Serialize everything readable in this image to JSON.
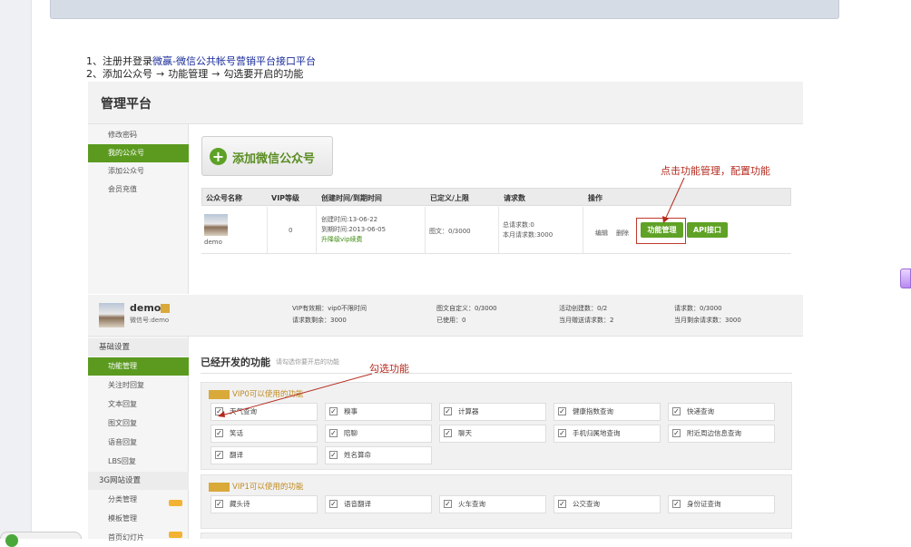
{
  "steps": {
    "s1_prefix": "1、注册并登录",
    "s1_link": "微赢-微信公共帐号营销平台接口平台",
    "s2_a": "2、添加公众号",
    "s2_arrow": "→",
    "s2_b": "功能管理",
    "s2_c": "勾选要开启的功能"
  },
  "panel1": {
    "title": "管理平台",
    "sidebar": [
      "修改密码",
      "我的公众号",
      "添加公众号",
      "会员充值"
    ],
    "add_button": "添加微信公众号",
    "plus": "+",
    "table_headers": [
      "公众号名称",
      "VIP等级",
      "创建时间/到期时间",
      "已定义/上限",
      "请求数",
      "操作"
    ],
    "row": {
      "name": "demo",
      "vip": "0",
      "created": "创建时间:13-06-22",
      "expires": "到期时间:2013-06-05",
      "upgrade": "升降级vip续费",
      "defined": "图文：0/3000",
      "total_req": "总请求数:0",
      "month_req": "本月请求数:3000",
      "edit": "编辑",
      "delete": "删除",
      "func_mgmt": "功能管理",
      "api": "API接口"
    },
    "annotation": "点击功能管理，配置功能"
  },
  "panel2": {
    "account_name": "demo",
    "account_wechat": "微信号:demo",
    "stats": [
      [
        "VIP有效期：vip0不限时间",
        "请求数剩余：3000"
      ],
      [
        "图文自定义：0/3000",
        "已使用：0"
      ],
      [
        "活动创建数：0/2",
        "当月赠送请求数：2"
      ],
      [
        "请求数：0/3000",
        "当月剩余请求数：3000"
      ]
    ],
    "sidebar": [
      {
        "label": "基础设置",
        "type": "group"
      },
      {
        "label": "功能管理",
        "type": "active"
      },
      {
        "label": "关注时回复",
        "type": "item"
      },
      {
        "label": "文本回复",
        "type": "item"
      },
      {
        "label": "图文回复",
        "type": "item"
      },
      {
        "label": "语音回复",
        "type": "item"
      },
      {
        "label": "LBS回复",
        "type": "item",
        "new": true
      },
      {
        "label": "3G网站设置",
        "type": "group"
      },
      {
        "label": "分类管理",
        "type": "item"
      },
      {
        "label": "模板管理",
        "type": "item"
      },
      {
        "label": "首页幻灯片",
        "type": "item",
        "new": true
      }
    ],
    "section_title": "已经开发的功能",
    "section_hint": "请勾选你要开启的功能",
    "annotation": "勾选功能",
    "vip0_label": "VIP0可以使用的功能",
    "vip0_features": [
      "天气查询",
      "糗事",
      "计算器",
      "健康指数查询",
      "快递查询",
      "笑话",
      "陪聊",
      "聊天",
      "手机归属地查询",
      "附近周边信息查询",
      "翻译",
      "姓名算命"
    ],
    "vip1_label": "VIP1可以使用的功能",
    "vip1_features": [
      "藏头诗",
      "语音翻译",
      "火车查询",
      "公交查询",
      "身份证查询"
    ],
    "check": "✓"
  }
}
